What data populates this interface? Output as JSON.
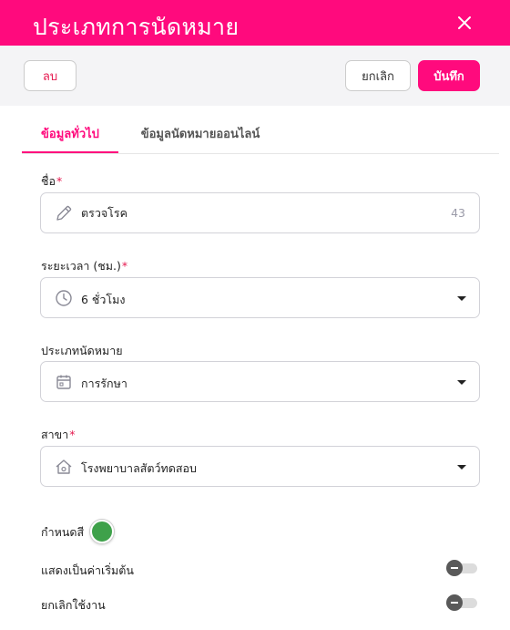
{
  "header": {
    "title": "ประเภทการนัดหมาย"
  },
  "toolbar": {
    "delete_label": "ลบ",
    "cancel_label": "ยกเลิก",
    "save_label": "บันทึก"
  },
  "tabs": [
    {
      "label": "ข้อมูลทั่วไป",
      "active": true
    },
    {
      "label": "ข้อมูลนัดหมายออนไลน์",
      "active": false
    }
  ],
  "form": {
    "name": {
      "label": "ชื่อ",
      "required": "*",
      "value": "ตรวจโรค",
      "counter": "43",
      "icon": "pencil-icon"
    },
    "duration": {
      "label": "ระยะเวลา (ชม.)",
      "required": "*",
      "value": "6 ชั่วโมง",
      "icon": "clock-icon"
    },
    "type": {
      "label": "ประเภทนัดหมาย",
      "value": "การรักษา",
      "icon": "calendar-icon"
    },
    "branch": {
      "label": "สาขา",
      "required": "*",
      "value": "โรงพยาบาลสัตว์ทดสอบ",
      "icon": "house-gear-icon"
    },
    "color": {
      "label": "กำหนดสี",
      "value": "#3ea14a"
    },
    "set_default": {
      "label": "แสดงเป็นค่าเริ่มต้น",
      "on": false
    },
    "disable": {
      "label": "ยกเลิกใช้งาน",
      "on": false
    }
  },
  "colors": {
    "accent": "#ff0a7d",
    "danger": "#e5194f",
    "toggle_knob": "#595959"
  }
}
